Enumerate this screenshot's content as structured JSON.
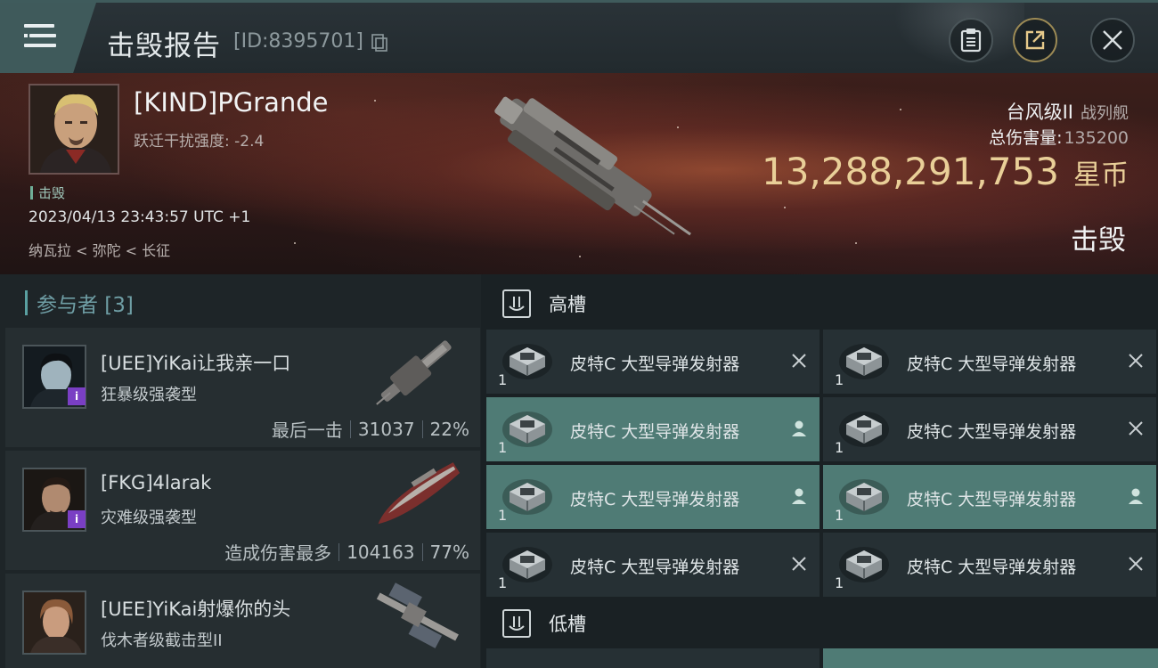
{
  "header": {
    "title": "击毁报告",
    "report_id": "[ID:8395701]"
  },
  "victim": {
    "name": "[KIND]PGrande",
    "warp_scramble": "跃迁干扰强度: -2.4",
    "status": "击毁",
    "timestamp": "2023/04/13 23:43:57 UTC +1",
    "location": "纳瓦拉 < 弥陀 < 长征",
    "ship_name": "台风级II",
    "ship_category": "战列舰",
    "total_damage_label": "总伤害量:",
    "total_damage_value": "135200",
    "isk_amount": "13,288,291,753",
    "isk_unit": "星币",
    "outcome": "击毁"
  },
  "participants": {
    "header": "参与者 [3]",
    "items": [
      {
        "name": "[UEE]YiKai让我亲一口",
        "ship": "狂暴级强袭型",
        "note": "最后一击",
        "damage": "31037",
        "percent": "22%"
      },
      {
        "name": "[FKG]4larak",
        "ship": "灾难级强袭型",
        "note": "造成伤害最多",
        "damage": "104163",
        "percent": "77%"
      },
      {
        "name": "[UEE]YiKai射爆你的头",
        "ship": "伐木者级截击型II"
      }
    ]
  },
  "fitting": {
    "high_slot_label": "高槽",
    "low_slot_label": "低槽",
    "modules": [
      {
        "name": "皮特C 大型导弹发射器",
        "qty": "1",
        "state": "destroyed"
      },
      {
        "name": "皮特C 大型导弹发射器",
        "qty": "1",
        "state": "destroyed"
      },
      {
        "name": "皮特C 大型导弹发射器",
        "qty": "1",
        "state": "dropped"
      },
      {
        "name": "皮特C 大型导弹发射器",
        "qty": "1",
        "state": "destroyed"
      },
      {
        "name": "皮特C 大型导弹发射器",
        "qty": "1",
        "state": "dropped"
      },
      {
        "name": "皮特C 大型导弹发射器",
        "qty": "1",
        "state": "dropped"
      },
      {
        "name": "皮特C 大型导弹发射器",
        "qty": "1",
        "state": "destroyed"
      },
      {
        "name": "皮特C 大型导弹发射器",
        "qty": "1",
        "state": "destroyed"
      }
    ]
  },
  "colors": {
    "accent_teal": "#4f7b75",
    "isk_gold": "#e9cf98",
    "corp_badge": "#7a3fc4"
  }
}
